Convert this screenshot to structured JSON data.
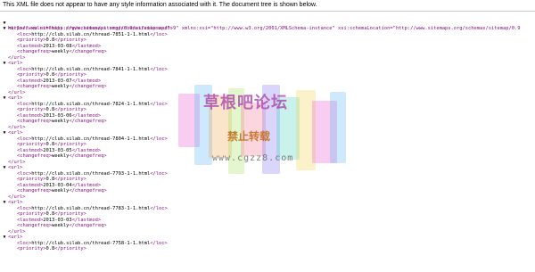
{
  "info_message": "This XML file does not appear to have any style information associated with it. The document tree is shown below.",
  "urlset_open_line1": "<urlset xmlns=\"http://www.sitemaps.org/schemas/sitemap/0.9\" xmlns:xsi=\"http://www.w3.org/2001/XMLSchema-instance\" xsi:schemaLocation=\"http://www.sitemaps.org/schemas/sitemap/0.9",
  "urlset_open_line2": "http://www.sitemaps.org/schemas/sitemap/0.9/sitemap.xsd\">",
  "toggle_glyph": "▼",
  "url_open": "<url>",
  "url_close": "</url>",
  "entries": [
    {
      "loc": "http://club.silab.cn/thread-7851-1-1.html",
      "priority": "0.8",
      "lastmod": "2013-03-08",
      "changefreq": "weekly"
    },
    {
      "loc": "http://club.silab.cn/thread-7841-1-1.html",
      "priority": "0.8",
      "lastmod": "2013-03-07",
      "changefreq": "weekly"
    },
    {
      "loc": "http://club.silab.cn/thread-7824-1-1.html",
      "priority": "0.8",
      "lastmod": "2013-03-06",
      "changefreq": "weekly"
    },
    {
      "loc": "http://club.silab.cn/thread-7804-1-1.html",
      "priority": "0.8",
      "lastmod": "2013-03-05",
      "changefreq": "weekly"
    },
    {
      "loc": "http://club.silab.cn/thread-7793-1-1.html",
      "priority": "0.8",
      "lastmod": "2013-03-04",
      "changefreq": "weekly"
    },
    {
      "loc": "http://club.silab.cn/thread-7783-1-1.html",
      "priority": "0.8",
      "lastmod": "2013-03-03",
      "changefreq": "weekly"
    },
    {
      "loc": "http://club.silab.cn/thread-7758-1-1.html",
      "priority": "0.8",
      "lastmod": "",
      "changefreq": ""
    }
  ],
  "watermark": {
    "title": "草根吧论坛",
    "subtitle": "禁止转载",
    "url": "www.cgzz8.com",
    "colors": [
      "#e84bd0",
      "#4ab0f0",
      "#f0a040",
      "#9be04a",
      "#f06a8a",
      "#7a6af0",
      "#40d0c0",
      "#f0d040"
    ]
  }
}
